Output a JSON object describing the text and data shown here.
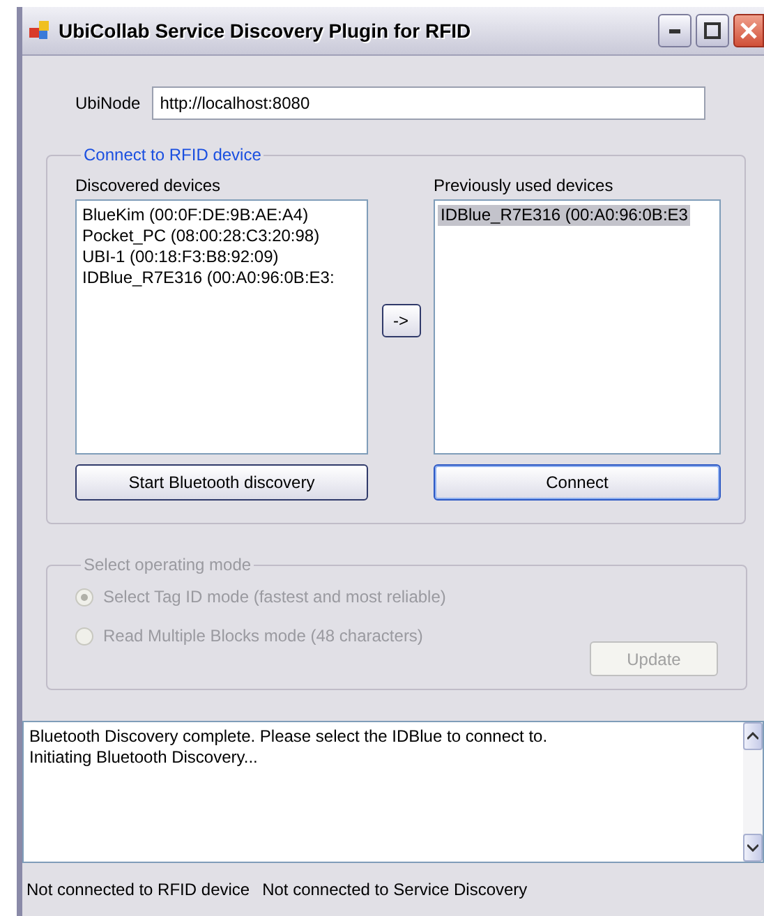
{
  "window": {
    "title": "UbiCollab Service Discovery Plugin for RFID"
  },
  "ubinode": {
    "label": "UbiNode",
    "value": "http://localhost:8080"
  },
  "connect_group": {
    "title": "Connect to RFID device",
    "discovered": {
      "label": "Discovered devices",
      "items": [
        {
          "text": "BlueKim (00:0F:DE:9B:AE:A4)",
          "selected": false
        },
        {
          "text": "Pocket_PC (08:00:28:C3:20:98)",
          "selected": false
        },
        {
          "text": "UBI-1 (00:18:F3:B8:92:09)",
          "selected": false
        },
        {
          "text": "IDBlue_R7E316 (00:A0:96:0B:E3:",
          "selected": false
        }
      ]
    },
    "move_button": "->",
    "previous": {
      "label": "Previously used devices",
      "items": [
        {
          "text": "IDBlue_R7E316 (00:A0:96:0B:E3",
          "selected": true
        }
      ]
    },
    "discover_button": "Start Bluetooth discovery",
    "connect_button": "Connect"
  },
  "mode_group": {
    "title": "Select operating mode",
    "disabled": true,
    "options": [
      {
        "label": "Select Tag ID mode (fastest and most reliable)",
        "selected": true
      },
      {
        "label": "Read Multiple Blocks mode (48 characters)",
        "selected": false
      }
    ],
    "update_button": "Update"
  },
  "log": [
    "Bluetooth Discovery complete. Please select the IDBlue to connect to.",
    "Initiating Bluetooth Discovery..."
  ],
  "status_bar": [
    "Not connected to RFID device",
    "Not connected to Service Discovery"
  ]
}
